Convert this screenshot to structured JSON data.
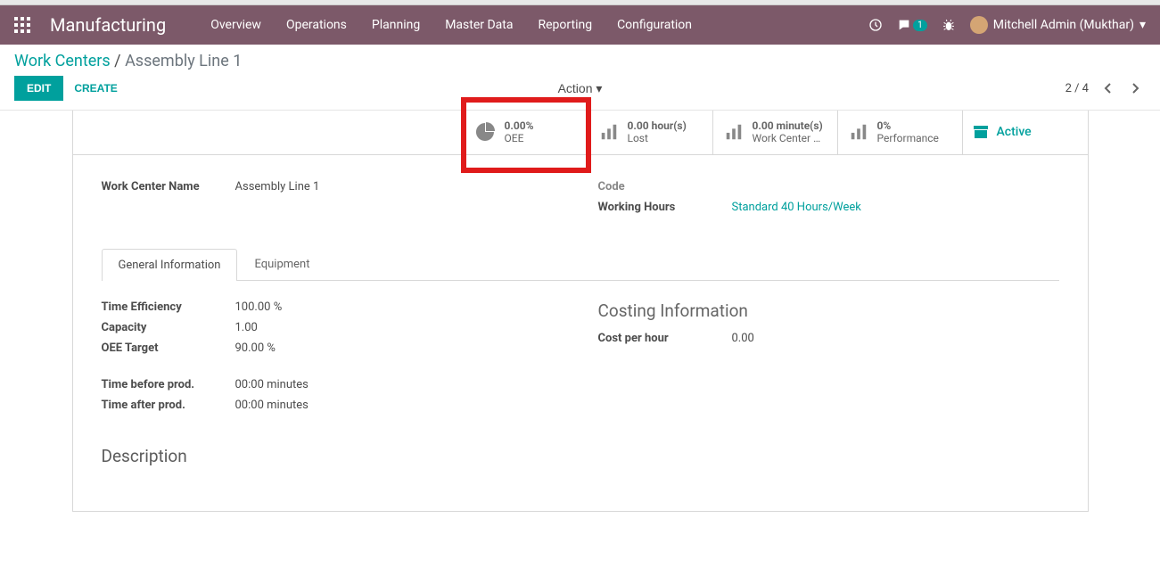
{
  "nav": {
    "brand": "Manufacturing",
    "menu": [
      "Overview",
      "Operations",
      "Planning",
      "Master Data",
      "Reporting",
      "Configuration"
    ],
    "msg_count": "1",
    "user": "Mitchell Admin (Mukthar)"
  },
  "breadcrumb": {
    "parent": "Work Centers",
    "current": "Assembly Line 1"
  },
  "actions": {
    "edit": "EDIT",
    "create": "CREATE",
    "action": "Action"
  },
  "pager": {
    "text": "2 / 4"
  },
  "stats": {
    "oee": {
      "val": "0.00%",
      "label": "OEE"
    },
    "lost": {
      "val": "0.00 hour(s)",
      "label": "Lost"
    },
    "load": {
      "val": "0.00 minute(s)",
      "label": "Work Center …"
    },
    "perf": {
      "val": "0%",
      "label": "Performance"
    },
    "active": "Active"
  },
  "fields": {
    "name_label": "Work Center Name",
    "name_value": "Assembly Line 1",
    "code_label": "Code",
    "hours_label": "Working Hours",
    "hours_value": "Standard 40 Hours/Week"
  },
  "tabs": {
    "general": "General Information",
    "equipment": "Equipment"
  },
  "general": {
    "te_label": "Time Efficiency",
    "te_value": "100.00",
    "te_unit": " %",
    "cap_label": "Capacity",
    "cap_value": "1.00",
    "oee_label": "OEE Target",
    "oee_value": "90.00",
    "oee_unit": " %",
    "tb_label": "Time before prod.",
    "tb_value": "00:00",
    "tb_unit": " minutes",
    "ta_label": "Time after prod.",
    "ta_value": "00:00",
    "ta_unit": " minutes"
  },
  "costing": {
    "head": "Costing Information",
    "cph_label": "Cost per hour",
    "cph_value": "0.00"
  },
  "desc": {
    "head": "Description"
  }
}
